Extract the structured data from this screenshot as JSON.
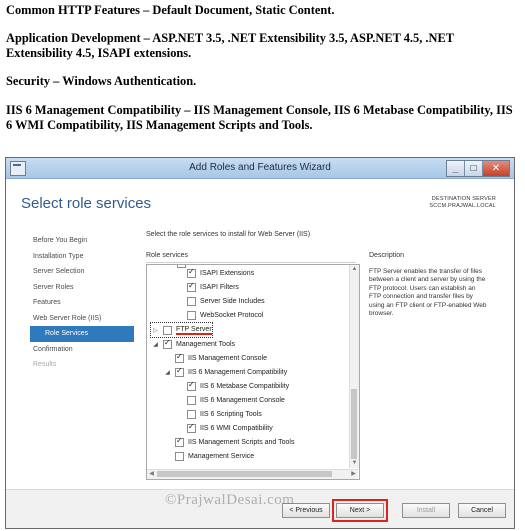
{
  "document": {
    "p1": "Common HTTP Features – Default Document, Static Content.",
    "p2": "Application Development – ASP.NET 3.5, .NET Extensibility 3.5, ASP.NET 4.5, .NET Extensibility 4.5, ISAPI extensions.",
    "p3": "Security – Windows Authentication.",
    "p4": "IIS 6 Management Compatibility – IIS Management Console, IIS 6 Metabase Compatibility, IIS 6 WMI Compatibility, IIS Management Scripts and Tools."
  },
  "window": {
    "title": "Add Roles and Features Wizard",
    "header_title": "Select role services",
    "destination_label": "DESTINATION SERVER",
    "destination_server": "SCCM.PRAJWAL.LOCAL"
  },
  "nav": {
    "items": [
      {
        "label": "Before You Begin",
        "state": "normal"
      },
      {
        "label": "Installation Type",
        "state": "normal"
      },
      {
        "label": "Server Selection",
        "state": "normal"
      },
      {
        "label": "Server Roles",
        "state": "normal"
      },
      {
        "label": "Features",
        "state": "normal"
      },
      {
        "label": "Web Server Role (IIS)",
        "state": "normal"
      },
      {
        "label": "Role Services",
        "state": "active"
      },
      {
        "label": "Confirmation",
        "state": "normal"
      },
      {
        "label": "Results",
        "state": "dim"
      }
    ]
  },
  "main": {
    "instruction": "Select the role services to install for Web Server (IIS)",
    "role_services_label": "Role services",
    "description_label": "Description",
    "description_text": "FTP Server enables the transfer of files between a client and server by using the FTP protocol. Users can establish an FTP connection and transfer files by using an FTP client or FTP-enabled Web browser."
  },
  "tree": {
    "items": [
      {
        "label": "ISAPI Extensions",
        "checked": true
      },
      {
        "label": "ISAPI Filters",
        "checked": true
      },
      {
        "label": "Server Side Includes",
        "checked": false
      },
      {
        "label": "WebSocket Protocol",
        "checked": false
      },
      {
        "label": "FTP Server",
        "checked": false
      },
      {
        "label": "Management Tools",
        "checked": true
      },
      {
        "label": "IIS Management Console",
        "checked": true
      },
      {
        "label": "IIS 6 Management Compatibility",
        "checked": true
      },
      {
        "label": "IIS 6 Metabase Compatibility",
        "checked": true
      },
      {
        "label": "IIS 6 Management Console",
        "checked": false
      },
      {
        "label": "IIS 6 Scripting Tools",
        "checked": false
      },
      {
        "label": "IIS 6 WMI Compatibility",
        "checked": true
      },
      {
        "label": "IIS Management Scripts and Tools",
        "checked": true
      },
      {
        "label": "Management Service",
        "checked": false
      }
    ]
  },
  "buttons": {
    "previous": "< Previous",
    "next": "Next >",
    "install": "Install",
    "cancel": "Cancel"
  },
  "watermark": "©PrajwalDesai.com"
}
